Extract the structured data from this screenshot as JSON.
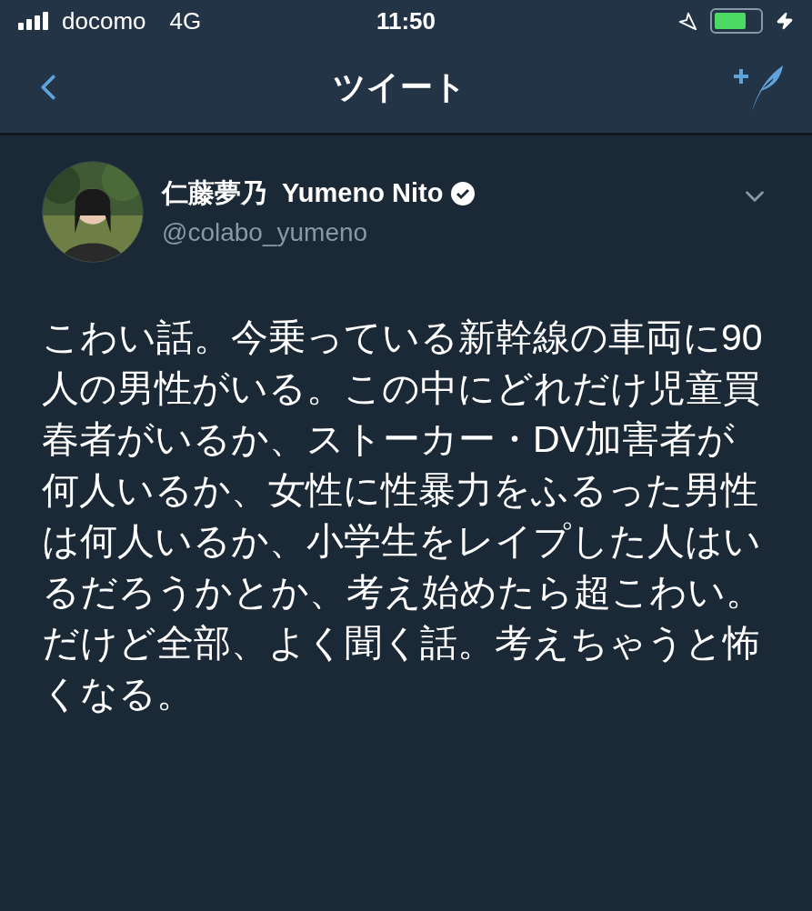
{
  "status_bar": {
    "carrier": "docomo",
    "network": "4G",
    "time": "11:50"
  },
  "nav": {
    "title": "ツイート"
  },
  "tweet": {
    "display_name": "仁藤夢乃  Yumeno Nito",
    "verified": true,
    "handle": "@colabo_yumeno",
    "text": "こわい話。今乗っている新幹線の車両に90人の男性がいる。この中にどれだけ児童買春者がいるか、ストーカー・DV加害者が何人いるか、女性に性暴力をふるった男性は何人いるか、小学生をレイプした人はいるだろうかとか、考え始めたら超こわい。だけど全部、よく聞く話。考えちゃうと怖くなる。"
  }
}
